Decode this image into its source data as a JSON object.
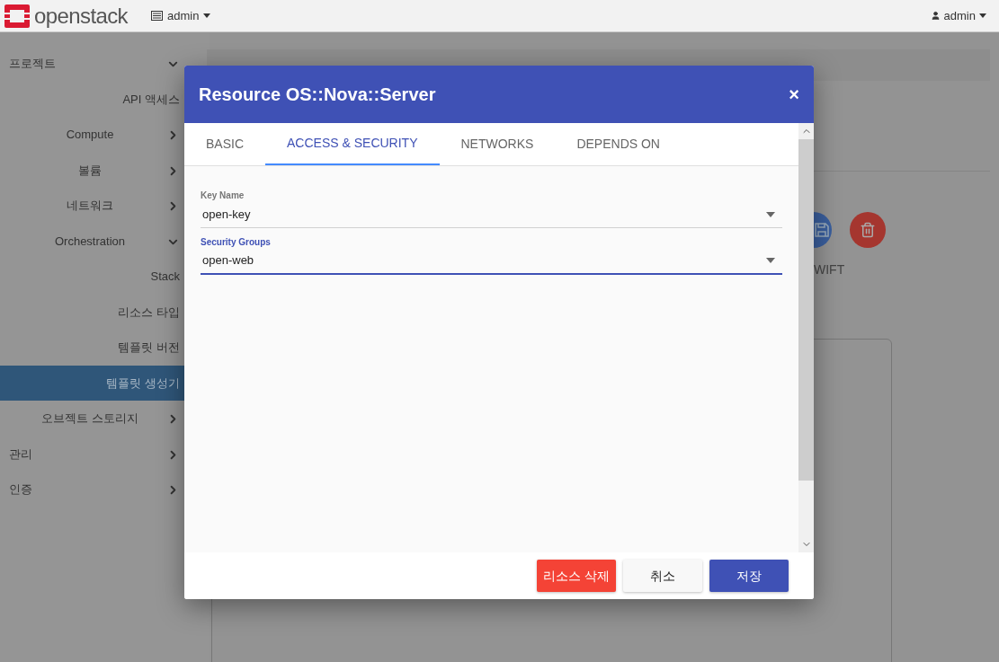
{
  "topbar": {
    "brand": "openstack",
    "project_menu": "admin",
    "user_menu": "admin"
  },
  "sidebar": {
    "items": [
      {
        "label": "프로젝트",
        "expanded": true,
        "selected": false,
        "children": [
          {
            "label": "API 액세스",
            "selected": false
          },
          {
            "label": "Compute",
            "expanded": false,
            "selected": false
          },
          {
            "label": "볼륨",
            "expanded": false,
            "selected": false
          },
          {
            "label": "네트워크",
            "expanded": false,
            "selected": false
          },
          {
            "label": "Orchestration",
            "expanded": true,
            "selected": false,
            "children": [
              {
                "label": "Stack",
                "selected": false
              },
              {
                "label": "리소스 타입",
                "selected": false
              },
              {
                "label": "템플릿 버전",
                "selected": false
              },
              {
                "label": "템플릿 생성기",
                "selected": true
              }
            ]
          },
          {
            "label": "오브젝트 스토리지",
            "expanded": false,
            "selected": false
          }
        ]
      },
      {
        "label": "관리",
        "expanded": false,
        "selected": false
      },
      {
        "label": "인증",
        "expanded": false,
        "selected": false
      }
    ]
  },
  "toolbar": {
    "partial_label": "WIFT"
  },
  "dialog": {
    "title": "Resource OS::Nova::Server",
    "close": "×",
    "tabs": [
      {
        "label": "BASIC",
        "selected": false
      },
      {
        "label": "ACCESS & SECURITY",
        "selected": true
      },
      {
        "label": "NETWORKS",
        "selected": false
      },
      {
        "label": "DEPENDS ON",
        "selected": false
      }
    ],
    "fields": [
      {
        "label": "Key Name",
        "value": "open-key",
        "focused": false
      },
      {
        "label": "Security Groups",
        "value": "open-web",
        "focused": true
      }
    ],
    "buttons": [
      {
        "label": "리소스 삭제",
        "kind": "danger"
      },
      {
        "label": "취소",
        "kind": "plain"
      },
      {
        "label": "저장",
        "kind": "primary"
      }
    ]
  }
}
